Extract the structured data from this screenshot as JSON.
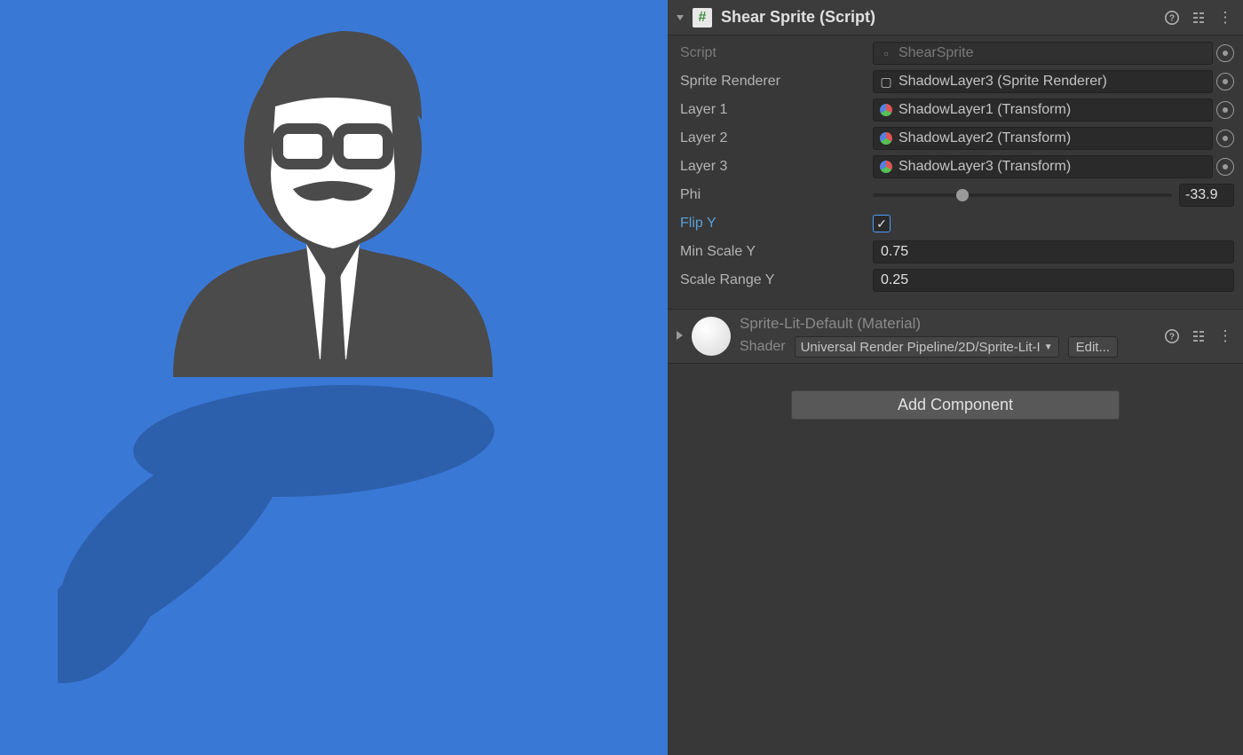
{
  "component": {
    "title": "Shear Sprite (Script)",
    "props": {
      "script": {
        "label": "Script",
        "value": "ShearSprite"
      },
      "spriteRenderer": {
        "label": "Sprite Renderer",
        "value": "ShadowLayer3 (Sprite Renderer)"
      },
      "layer1": {
        "label": "Layer 1",
        "value": "ShadowLayer1 (Transform)"
      },
      "layer2": {
        "label": "Layer 2",
        "value": "ShadowLayer2 (Transform)"
      },
      "layer3": {
        "label": "Layer 3",
        "value": "ShadowLayer3 (Transform)"
      },
      "phi": {
        "label": "Phi",
        "value": "-33.9"
      },
      "flipY": {
        "label": "Flip Y",
        "checked": true
      },
      "minScaleY": {
        "label": "Min Scale Y",
        "value": "0.75"
      },
      "scaleRangeY": {
        "label": "Scale Range Y",
        "value": "0.25"
      }
    }
  },
  "material": {
    "title": "Sprite-Lit-Default (Material)",
    "shaderLabel": "Shader",
    "shaderValue": "Universal Render Pipeline/2D/Sprite-Lit-I",
    "editLabel": "Edit..."
  },
  "addComponent": "Add Component"
}
